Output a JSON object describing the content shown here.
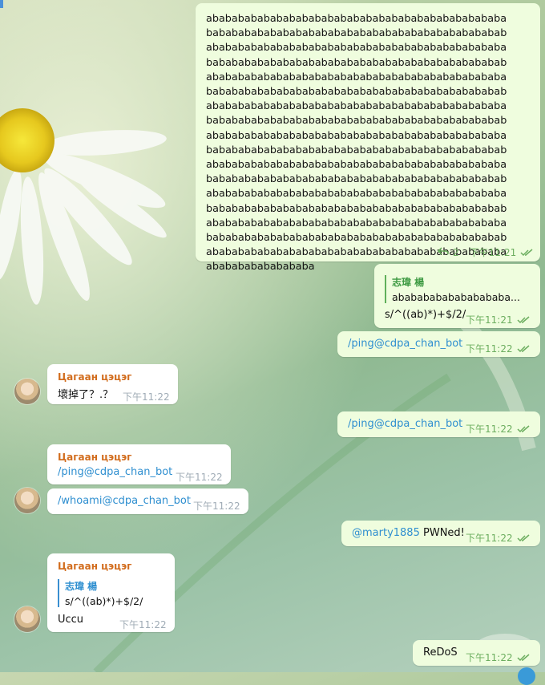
{
  "chat": {
    "messages": [
      {
        "id": "m1",
        "direction": "outgoing",
        "text_lines": [
          "abababababababababababababababababababababababa",
          "bababababababababababababababababababababababab",
          "abababababababababababababababababababababababa",
          "bababababababababababababababababababababababab",
          "abababababababababababababababababababababababa",
          "bababababababababababababababababababababababab",
          "abababababababababababababababababababababababa",
          "bababababababababababababababababababababababab",
          "abababababababababababababababababababababababa",
          "bababababababababababababababababababababababab",
          "abababababababababababababababababababababababa",
          "bababababababababababababababababababababababab",
          "abababababababababababababababababababababababa",
          "bababababababababababababababababababababababab",
          "abababababababababababababababababababababababa",
          "bababababababababababababababababababababababab",
          "abababababababababababababababababababababababa",
          "ababababababababa"
        ],
        "replies_count": "2",
        "time": "下午11:21"
      },
      {
        "id": "m2",
        "direction": "outgoing",
        "quote_name": "志瑋 楊",
        "quote_text": "abababababababababa...",
        "text": "s/^((ab)*)+$/2/",
        "time": "下午11:21"
      },
      {
        "id": "m3",
        "direction": "outgoing",
        "text": "/ping@cdpa_chan_bot",
        "time": "下午11:22"
      },
      {
        "id": "m4",
        "direction": "incoming",
        "sender": "Цагаан цэцэг",
        "text": "壞掉了？.？",
        "time": "下午11:22"
      },
      {
        "id": "m5",
        "direction": "outgoing",
        "text": "/ping@cdpa_chan_bot",
        "time": "下午11:22"
      },
      {
        "id": "m6",
        "direction": "incoming",
        "sender": "Цагаан цэцэг",
        "text": "/ping@cdpa_chan_bot",
        "time": "下午11:22"
      },
      {
        "id": "m7",
        "direction": "incoming",
        "text": "/whoami@cdpa_chan_bot",
        "time": "下午11:22"
      },
      {
        "id": "m8",
        "direction": "outgoing",
        "mention": "@marty1885",
        "text": "PWNed!",
        "time": "下午11:22"
      },
      {
        "id": "m9",
        "direction": "incoming",
        "sender": "Цагаан цэцэг",
        "quote_name": "志瑋 楊",
        "quote_text": "s/^((ab)*)+$/2/",
        "text": "Uccu",
        "time": "下午11:22"
      },
      {
        "id": "m10",
        "direction": "outgoing",
        "text": "ReDoS",
        "time": "下午11:22"
      }
    ]
  },
  "colors": {
    "outgoing_bubble": "#effdde",
    "incoming_bubble": "#ffffff",
    "sender_name": "#d26d1e",
    "link": "#2f8fd0",
    "outgoing_meta": "#6cae5f",
    "quote_green": "#3d9a42"
  },
  "icons": {
    "read_status": "double-check-icon",
    "replies": "reply-arrow-icon"
  }
}
